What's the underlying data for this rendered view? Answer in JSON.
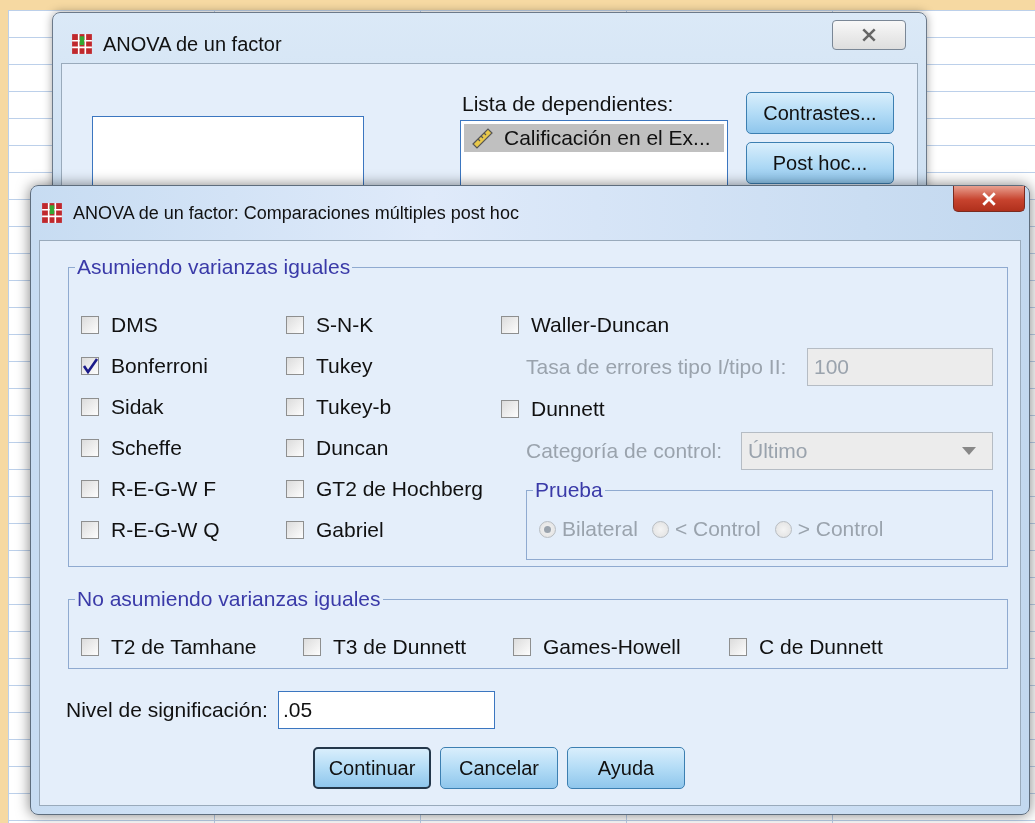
{
  "background_window": {
    "title": "ANOVA de un factor",
    "list_label": "Lista de dependientes:",
    "list_items": [
      {
        "label": "Calificación en el Ex...",
        "selected": true
      }
    ],
    "buttons": [
      "Contrastes...",
      "Post hoc..."
    ]
  },
  "dialog": {
    "title": "ANOVA de un factor: Comparaciones múltiples post hoc",
    "equal_variances": {
      "legend": "Asumiendo varianzas iguales",
      "columns": [
        [
          {
            "label": "DMS",
            "checked": false
          },
          {
            "label": "Bonferroni",
            "checked": true
          },
          {
            "label": "Sidak",
            "checked": false
          },
          {
            "label": "Scheffe",
            "checked": false
          },
          {
            "label": "R-E-G-W F",
            "checked": false
          },
          {
            "label": "R-E-G-W Q",
            "checked": false
          }
        ],
        [
          {
            "label": "S-N-K",
            "checked": false
          },
          {
            "label": "Tukey",
            "checked": false
          },
          {
            "label": "Tukey-b",
            "checked": false
          },
          {
            "label": "Duncan",
            "checked": false
          },
          {
            "label": "GT2 de Hochberg",
            "checked": false
          },
          {
            "label": "Gabriel",
            "checked": false
          }
        ]
      ],
      "options": [
        {
          "kind": "checkbox",
          "label": "Waller-Duncan",
          "checked": false
        },
        {
          "kind": "field",
          "label": "Tasa de errores tipo I/tipo II:",
          "value": "100",
          "disabled": true
        },
        {
          "kind": "checkbox",
          "label": "Dunnett",
          "checked": false
        },
        {
          "kind": "select",
          "label": "Categoría de control:",
          "value": "Último",
          "disabled": true
        },
        {
          "kind": "radio_group",
          "legend": "Prueba",
          "disabled": true,
          "radios": [
            {
              "label": "Bilateral",
              "selected": true
            },
            {
              "label": "< Control",
              "selected": false
            },
            {
              "label": "> Control",
              "selected": false
            }
          ]
        }
      ]
    },
    "unequal_variances": {
      "legend": "No asumiendo varianzas iguales",
      "items": [
        {
          "label": "T2 de Tamhane",
          "checked": false
        },
        {
          "label": "T3 de Dunnett",
          "checked": false
        },
        {
          "label": "Games-Howell",
          "checked": false
        },
        {
          "label": "C de Dunnett",
          "checked": false
        }
      ]
    },
    "significance": {
      "label": "Nivel de significación:",
      "value": ".05"
    },
    "buttons": [
      {
        "label": "Continuar",
        "default": true
      },
      {
        "label": "Cancelar",
        "default": false
      },
      {
        "label": "Ayuda",
        "default": false
      }
    ]
  }
}
